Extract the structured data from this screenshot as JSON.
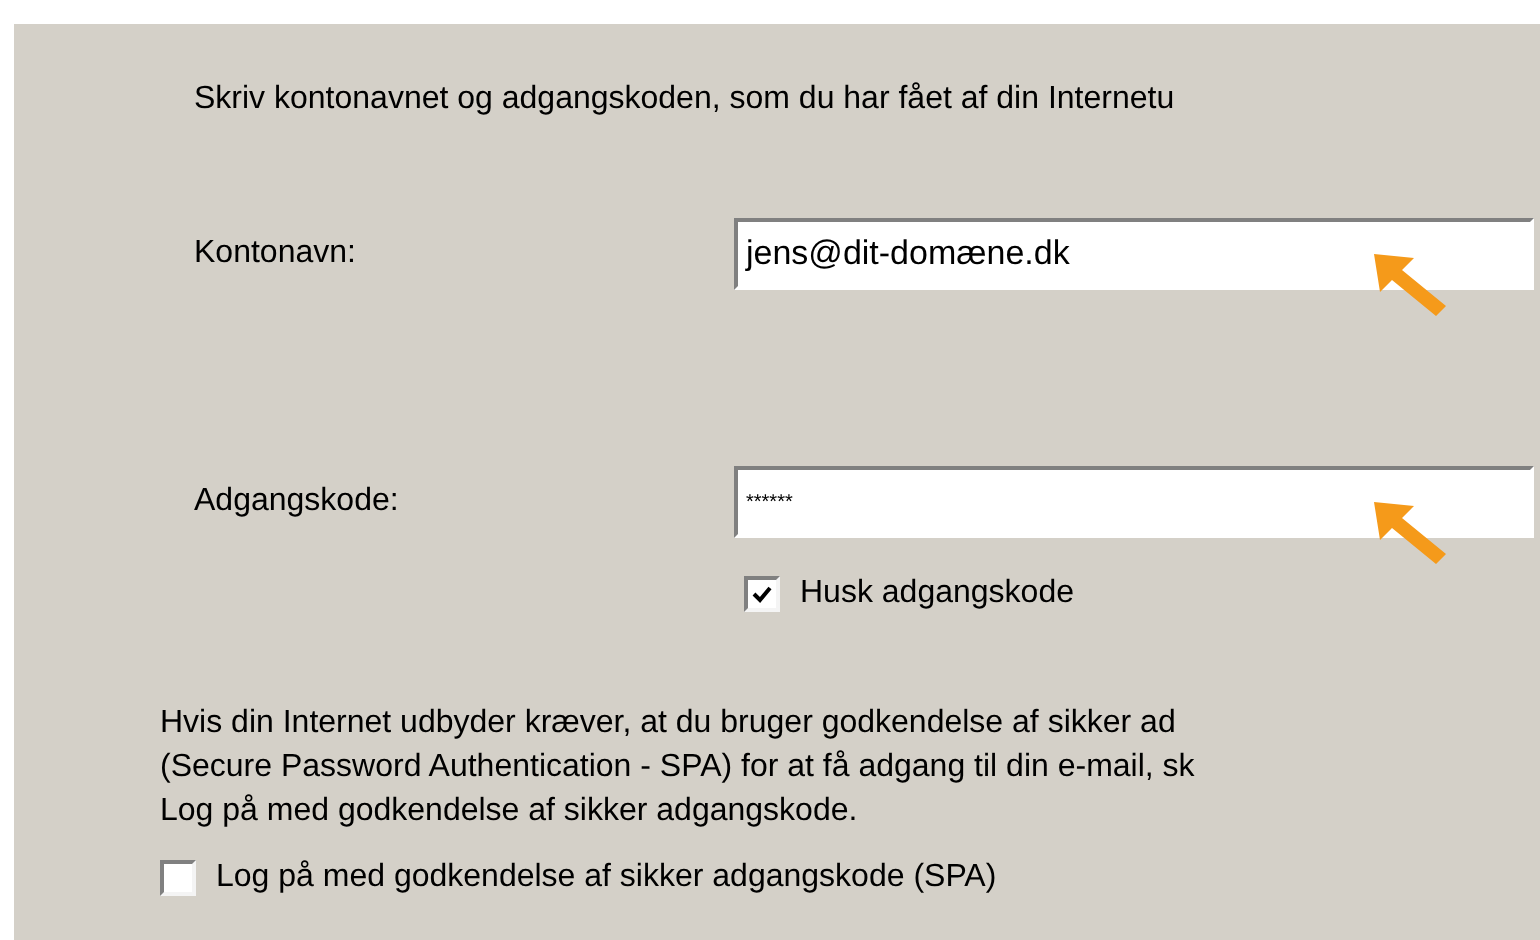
{
  "intro": "Skriv kontonavnet og adgangskoden, som du har fået af din Internetu",
  "fields": [
    {
      "label": "Kontonavn:",
      "value": "jens@dit-domæne.dk",
      "kind": "text"
    },
    {
      "label": "Adgangskode:",
      "value": "******",
      "kind": "password"
    }
  ],
  "remember": {
    "label": "Husk adgangskode",
    "checked": true
  },
  "spa_text": [
    "Hvis din Internet udbyder kræver, at du bruger godkendelse af sikker ad",
    "(Secure Password Authentication - SPA) for at få adgang til din e-mail, sk",
    "Log på med godkendelse af sikker adgangskode."
  ],
  "spa": {
    "label": "Log på med godkendelse af sikker adgangskode (SPA)",
    "checked": false
  }
}
